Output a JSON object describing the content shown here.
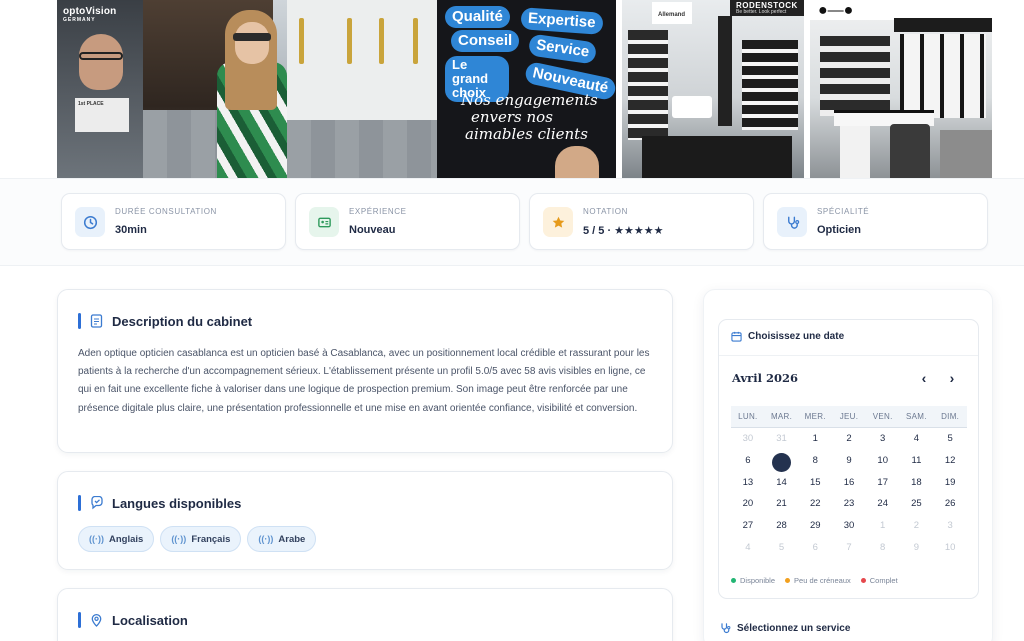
{
  "photos": {
    "ad_brand": "optoVision",
    "ad_brand_sub": "GERMANY",
    "ad_badge": "1st PLACE",
    "banner_pills": [
      "Qualité",
      "Expertise",
      "Conseil",
      "Service",
      "Le grand choix",
      "Nouveauté"
    ],
    "banner_text": [
      "Nos engagements",
      "envers nos",
      "aimables clients"
    ],
    "store_signs": [
      "Allemand",
      "RODENSTOCK",
      "Be better. Look perfect"
    ]
  },
  "stats": [
    {
      "label": "DURÉE CONSULTATION",
      "value": "30min",
      "icon": "clock-icon",
      "bg": "#e8f1fb",
      "fg": "#3b7bd0"
    },
    {
      "label": "EXPÉRIENCE",
      "value": "Nouveau",
      "icon": "id-card-icon",
      "bg": "#e6f5ec",
      "fg": "#2e9a5c"
    },
    {
      "label": "NOTATION",
      "value": "5 / 5 · ★★★★★",
      "icon": "star-icon",
      "bg": "#fdf1dc",
      "fg": "#e69a1a"
    },
    {
      "label": "SPÉCIALITÉ",
      "value": "Opticien",
      "icon": "stethoscope-icon",
      "bg": "#e8f1fb",
      "fg": "#3b7bd0"
    }
  ],
  "description": {
    "title": "Description du cabinet",
    "text": "Aden optique opticien casablanca est un opticien basé à Casablanca, avec un positionnement local crédible et rassurant pour les patients à la recherche d'un accompagnement sérieux. L'établissement présente un profil 5.0/5 avec 58 avis visibles en ligne, ce qui en fait une excellente fiche à valoriser dans une logique de prospection premium. Son image peut être renforcée par une présence digitale plus claire, une présentation professionnelle et une mise en avant orientée confiance, visibilité et conversion."
  },
  "languages": {
    "title": "Langues disponibles",
    "items": [
      "Anglais",
      "Français",
      "Arabe"
    ]
  },
  "location": {
    "title": "Localisation"
  },
  "booking": {
    "date_title": "Choisissez une date",
    "month": "Avril 2026",
    "prev": "‹",
    "next": "›",
    "weekdays": [
      "LUN.",
      "MAR.",
      "MER.",
      "JEU.",
      "VEN.",
      "SAM.",
      "DIM."
    ],
    "days": [
      {
        "d": "30",
        "m": true
      },
      {
        "d": "31",
        "m": true
      },
      {
        "d": "1"
      },
      {
        "d": "2"
      },
      {
        "d": "3"
      },
      {
        "d": "4"
      },
      {
        "d": "5"
      },
      {
        "d": "6"
      },
      {
        "d": "",
        "sel": true
      },
      {
        "d": "8"
      },
      {
        "d": "9"
      },
      {
        "d": "10"
      },
      {
        "d": "11"
      },
      {
        "d": "12"
      },
      {
        "d": "13"
      },
      {
        "d": "14"
      },
      {
        "d": "15"
      },
      {
        "d": "16"
      },
      {
        "d": "17"
      },
      {
        "d": "18"
      },
      {
        "d": "19"
      },
      {
        "d": "20"
      },
      {
        "d": "21"
      },
      {
        "d": "22"
      },
      {
        "d": "23"
      },
      {
        "d": "24"
      },
      {
        "d": "25"
      },
      {
        "d": "26"
      },
      {
        "d": "27"
      },
      {
        "d": "28"
      },
      {
        "d": "29"
      },
      {
        "d": "30"
      },
      {
        "d": "1",
        "m": true
      },
      {
        "d": "2",
        "m": true
      },
      {
        "d": "3",
        "m": true
      },
      {
        "d": "4",
        "m": true
      },
      {
        "d": "5",
        "m": true
      },
      {
        "d": "6",
        "m": true
      },
      {
        "d": "7",
        "m": true
      },
      {
        "d": "8",
        "m": true
      },
      {
        "d": "9",
        "m": true
      },
      {
        "d": "10",
        "m": true
      }
    ],
    "legend": [
      {
        "label": "Disponible",
        "color": "#22b573"
      },
      {
        "label": "Peu de créneaux",
        "color": "#f2a01e"
      },
      {
        "label": "Complet",
        "color": "#e5484d"
      }
    ],
    "service_title": "Sélectionnez un service"
  }
}
